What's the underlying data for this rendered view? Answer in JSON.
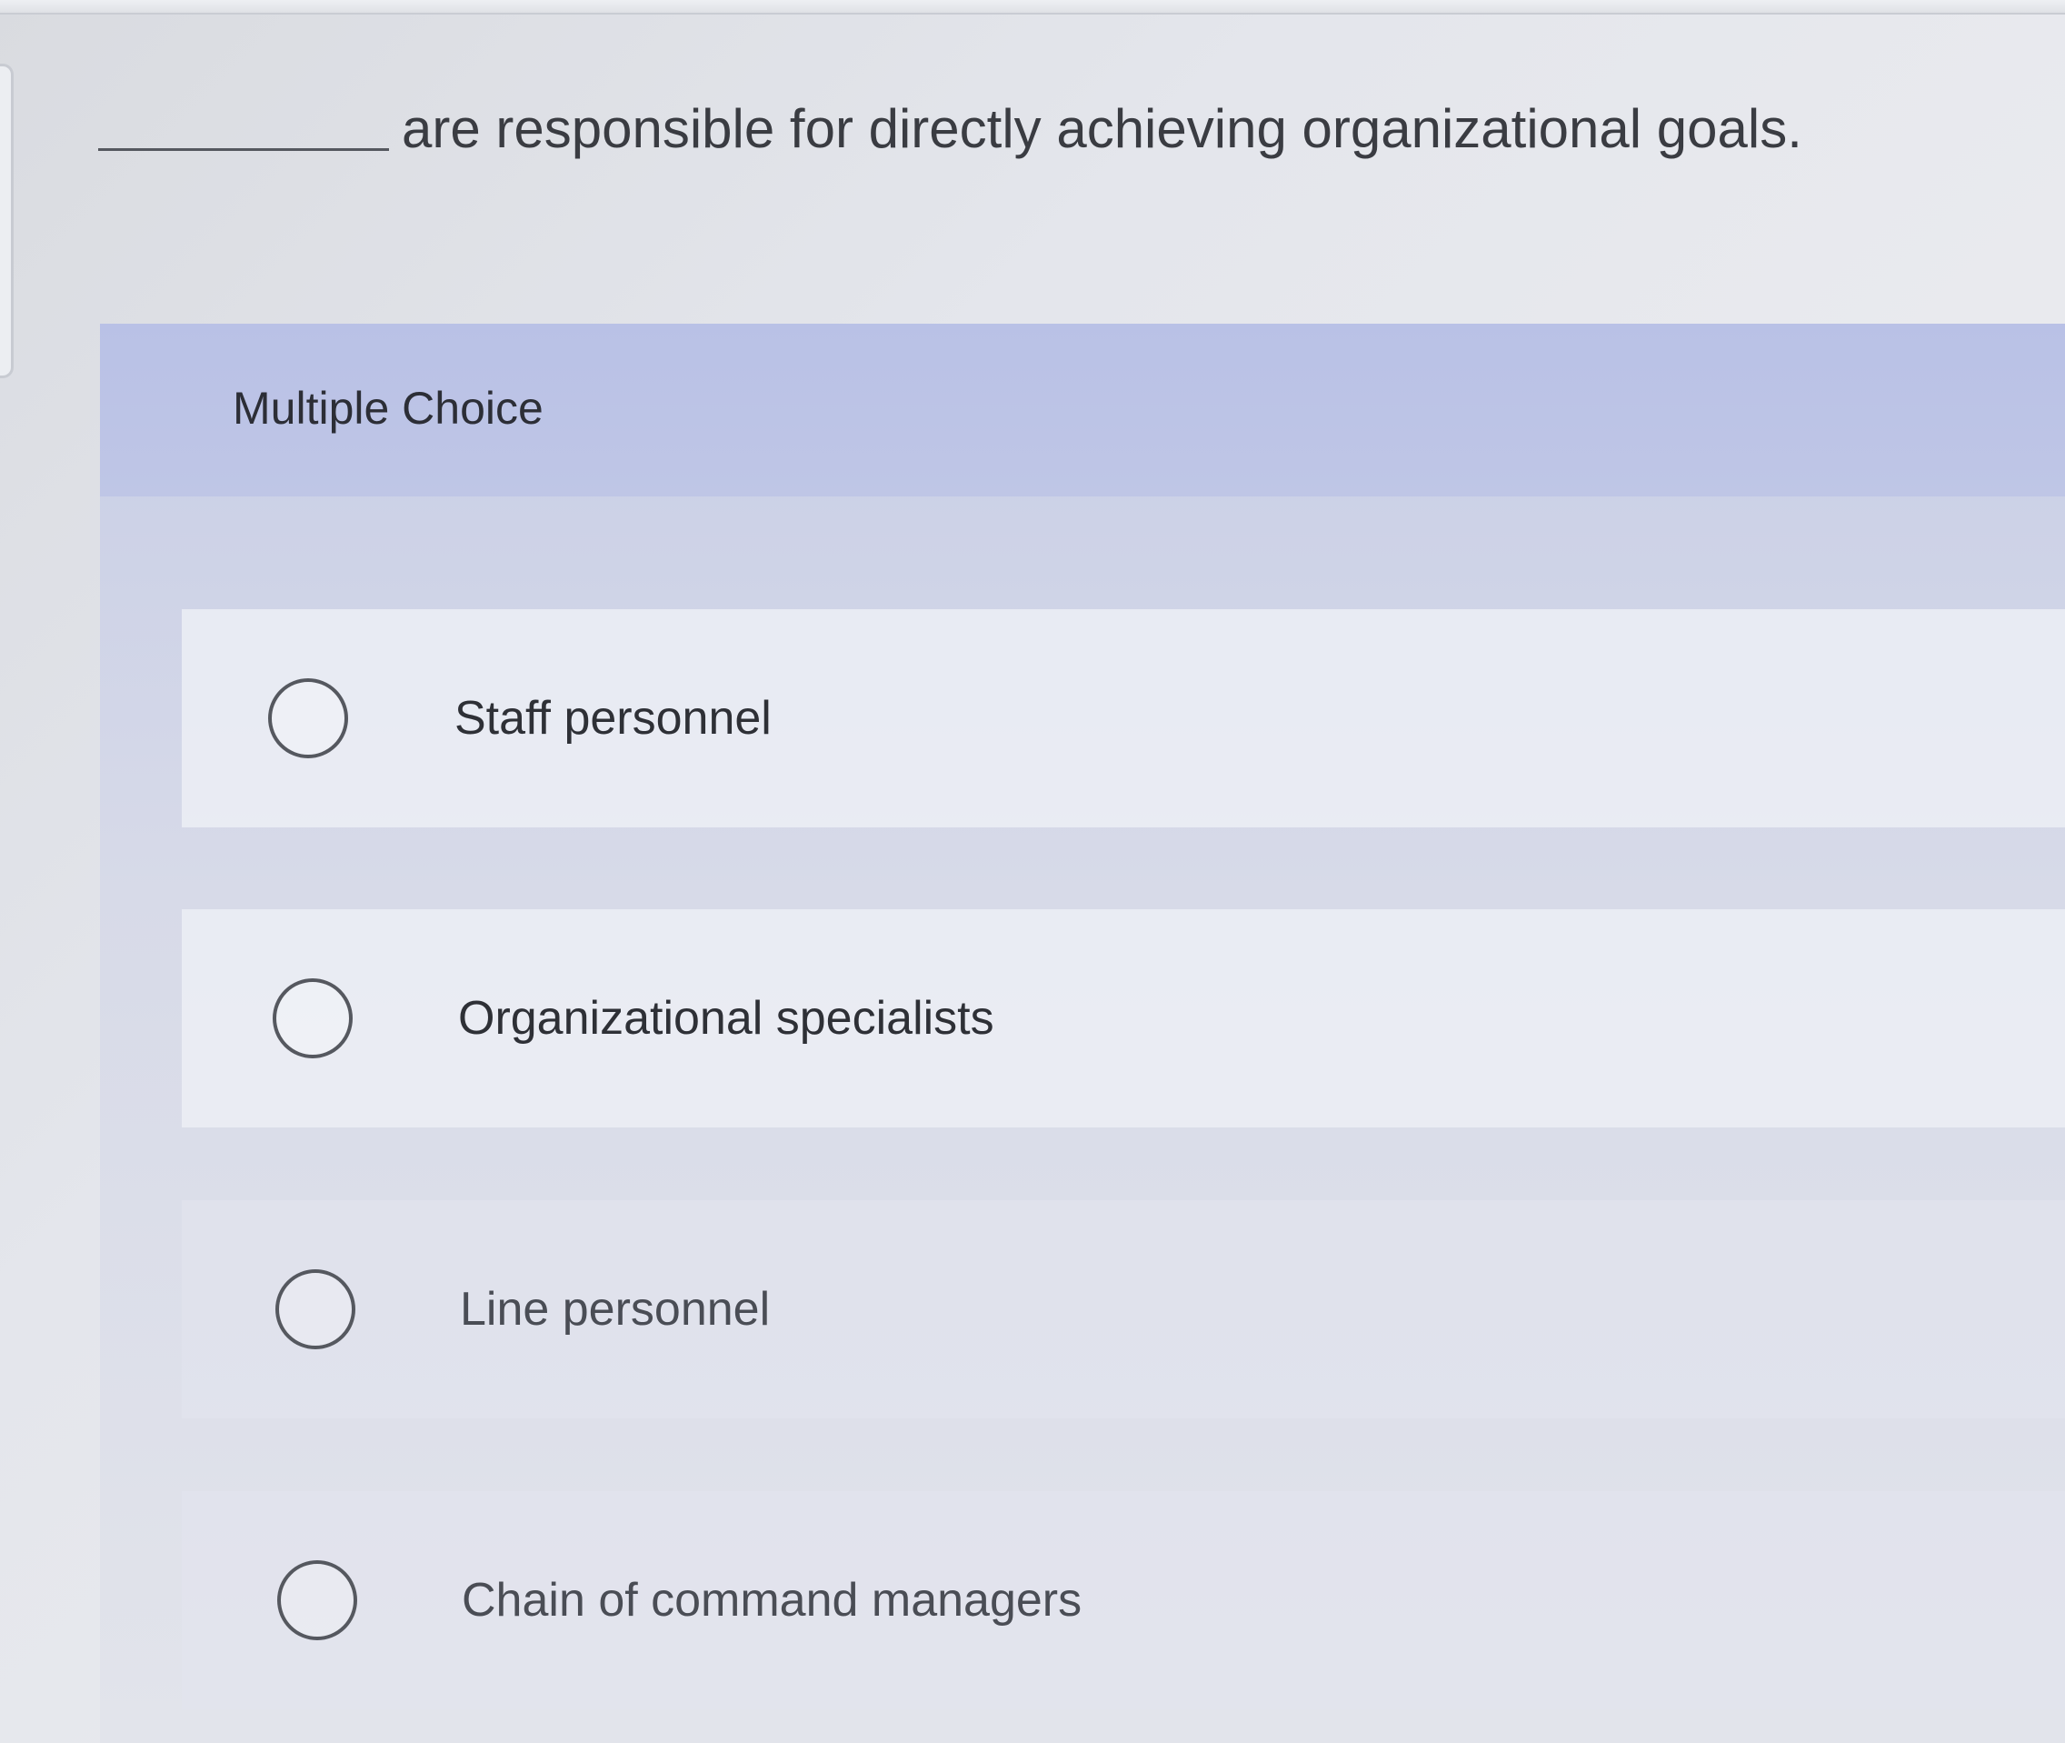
{
  "question": {
    "text": "are responsible for directly achieving organizational goals."
  },
  "multiple_choice": {
    "title": "Multiple Choice",
    "options": [
      {
        "label": "Staff personnel",
        "selected": false
      },
      {
        "label": "Organizational specialists",
        "selected": false
      },
      {
        "label": "Line personnel",
        "selected": false
      },
      {
        "label": "Chain of command managers",
        "selected": false
      }
    ]
  },
  "colors": {
    "page_background": "#e4e6ec",
    "header_band": "#bfc6e6",
    "option_row_light": "#eceef4",
    "radio_border": "#55585f",
    "text": "#2b2d33"
  }
}
